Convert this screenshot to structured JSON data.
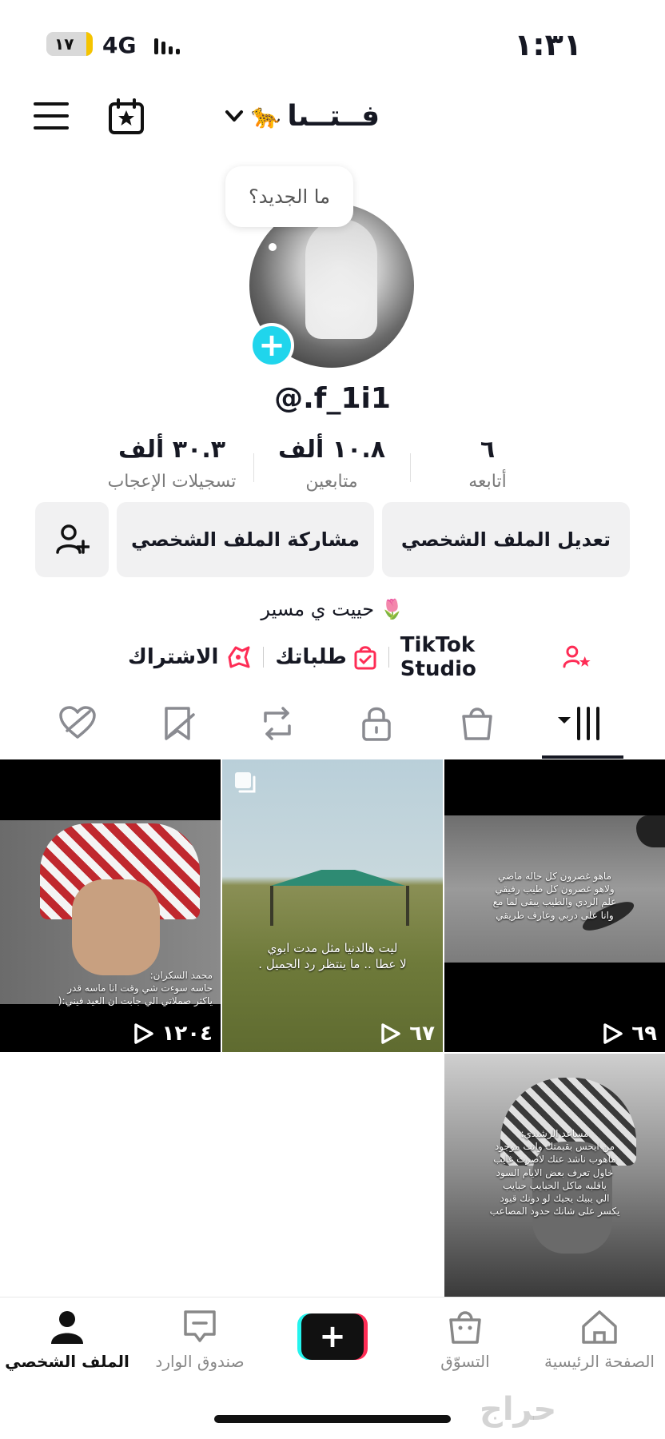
{
  "status": {
    "battery": "١٧",
    "network": "4G",
    "time": "١:٣١"
  },
  "header": {
    "username": "فــتــىا",
    "emoji": "🐆"
  },
  "profile": {
    "whats_new": "ما الجديد؟",
    "handle": "@.f_1i1",
    "stats": [
      {
        "value": "٣٠.٣ ألف",
        "label": "تسجيلات الإعجاب"
      },
      {
        "value": "١٠.٨ ألف",
        "label": "متابعين"
      },
      {
        "value": "٦",
        "label": "أتابعه"
      }
    ],
    "buttons": {
      "edit": "تعديل الملف الشخصي",
      "share": "مشاركة الملف الشخصي"
    },
    "bio": "حييت ي مسير 🌷",
    "links": {
      "studio": "TikTok Studio",
      "orders": "طلباتك",
      "subscribe": "الاشتراك"
    }
  },
  "videos": [
    {
      "views": "٦٩",
      "caption": "ماهو غصرون كل حاله ماضي\nولاهو غصرون كل طيب رفيقي\nعلم الردي والطيب يبقى لما مع\nوانا على دربي وعارف طريقي"
    },
    {
      "views": "٦٧",
      "caption": "ليت هالدنيا مثل مدت ابوي\nلا عطا .. ما ينتظر رد الجميل ."
    },
    {
      "views": "١٢٠٤",
      "caption": "محمد السكران:\nحاسه سوءت شي وقت انا ماسه قدر\nياكثر صملاتي الي جابت ان العيد فيني:("
    },
    {
      "views": "",
      "caption": "مساعد الرشيدي:\nمن ايحس بقيمتك وانت موجود\nماهوب ناشد عنك لاصرت غايب\nخاول تعرف بعض الايام السود\nياقلبه ماكل الحبايب حبايب\nالي يبيك يجيك لو دونك قيود\nيكسر على شانك حدود المصاعب"
    }
  ],
  "nav": {
    "home": "الصفحة الرئيسية",
    "shop": "التسوّق",
    "inbox": "صندوق الوارد",
    "profile": "الملف الشخصي"
  },
  "watermark": "حراج",
  "colors": {
    "accent_cyan": "#20d5ec",
    "accent_red": "#fe2c55",
    "text": "#161823"
  }
}
